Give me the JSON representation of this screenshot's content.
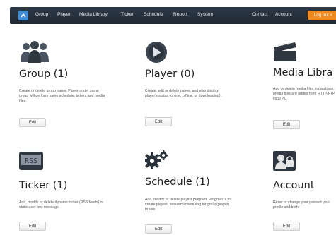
{
  "nav": {
    "items": [
      "Group",
      "Player",
      "Media Library",
      "Ticker",
      "Schedule",
      "Report",
      "System"
    ],
    "contact": "Contact",
    "account": "Account",
    "logout": "Log out ×"
  },
  "tiles": [
    {
      "title": "Group (1)",
      "desc": "Create or delete group name. Player under same group will perform same schedule, tickers and media files.",
      "edit": "Edit",
      "icon": "group-icon"
    },
    {
      "title": "Player (0)",
      "desc": "Create, edit or delete player, and also display player's status (online, offline, or downloading).",
      "edit": "Edit",
      "icon": "player-icon"
    },
    {
      "title": "Media Libra",
      "desc": "Add or delete media files in database. Media files are added from HTTP/FTP local PC.",
      "edit": "Edit",
      "icon": "clapperboard-icon"
    },
    {
      "title": "Ticker (1)",
      "desc": "Add, modify or delete dynamic ticker (RSS feeds) or static user text message.",
      "edit": "Edit",
      "icon": "rss-icon"
    },
    {
      "title": "Schedule (1)",
      "desc": "Add, modify or delete playlist program. Program is to create playlist, detailed scheduling for group(player) to use.",
      "edit": "Edit",
      "icon": "gears-icon"
    },
    {
      "title": "Account",
      "desc": "Reset or change your passwd your profile and both.",
      "edit": "Edit",
      "icon": "account-icon"
    }
  ]
}
